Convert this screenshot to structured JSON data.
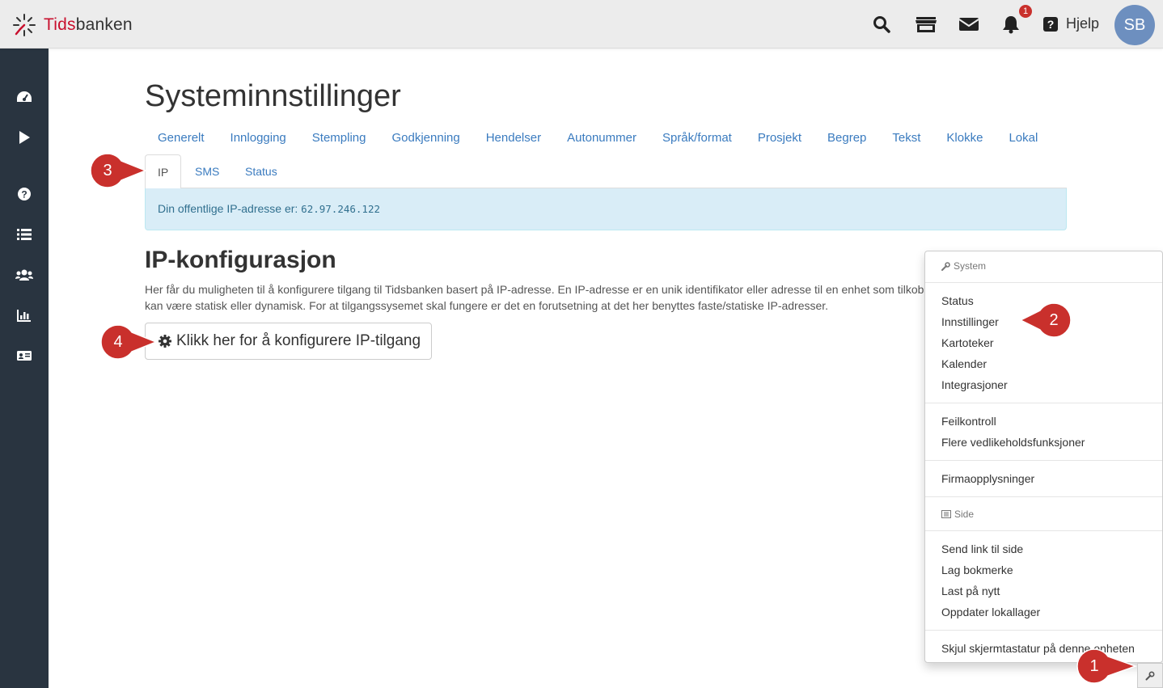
{
  "app": {
    "logo_text_a": "Tids",
    "logo_text_b": "banken",
    "brand_color": "#c8102e"
  },
  "topbar": {
    "icons": [
      "search-icon",
      "store-icon",
      "envelope-icon",
      "bell-icon"
    ],
    "notification_count": "1",
    "help_label": "Hjelp",
    "avatar_initials": "SB"
  },
  "sidebar": {
    "icons": [
      "dashboard-icon",
      "play-icon",
      "question-circle-icon",
      "list-icon",
      "users-icon",
      "bar-chart-icon",
      "id-card-icon"
    ]
  },
  "page": {
    "title": "Systeminnstillinger",
    "tabs": [
      "Generelt",
      "Innlogging",
      "Stempling",
      "Godkjenning",
      "Hendelser",
      "Autonummer",
      "Språk/format",
      "Prosjekt",
      "Begrep",
      "Tekst",
      "Klokke",
      "Lokal"
    ],
    "subtabs": [
      "IP",
      "SMS",
      "Status"
    ],
    "active_subtab": "IP",
    "alert_text": "Din offentlige IP-adresse er: ",
    "ip_address": "62.97.246.122",
    "section_title": "IP-konfigurasjon",
    "description": "Her får du muligheten til å konfigurere tilgang til Tidsbanken basert på IP-adresse. En IP-adresse er en unik identifikator eller adresse til en enhet som tilkoblet internett. En IP-adresse kan være statisk eller dynamisk. For at tilgangssysemet skal fungere er det en forutsetning at det her benyttes faste/statiske IP-adresser.",
    "config_button": "Klikk her for å konfigurere IP-tilgang"
  },
  "menu": {
    "system_header": "System",
    "system_items": [
      "Status",
      "Innstillinger",
      "Kartoteker",
      "Kalender",
      "Integrasjoner"
    ],
    "maintenance_items": [
      "Feilkontroll",
      "Flere vedlikeholdsfunksjoner"
    ],
    "company_item": "Firmaopplysninger",
    "side_header": "Side",
    "side_items": [
      "Send link til side",
      "Lag bokmerke",
      "Last på nytt",
      "Oppdater lokallager"
    ],
    "keyboard_item": "Skjul skjermtastatur på denne enheten"
  },
  "markers": [
    "1",
    "2",
    "3",
    "4"
  ],
  "marker_color": "#c9302c"
}
